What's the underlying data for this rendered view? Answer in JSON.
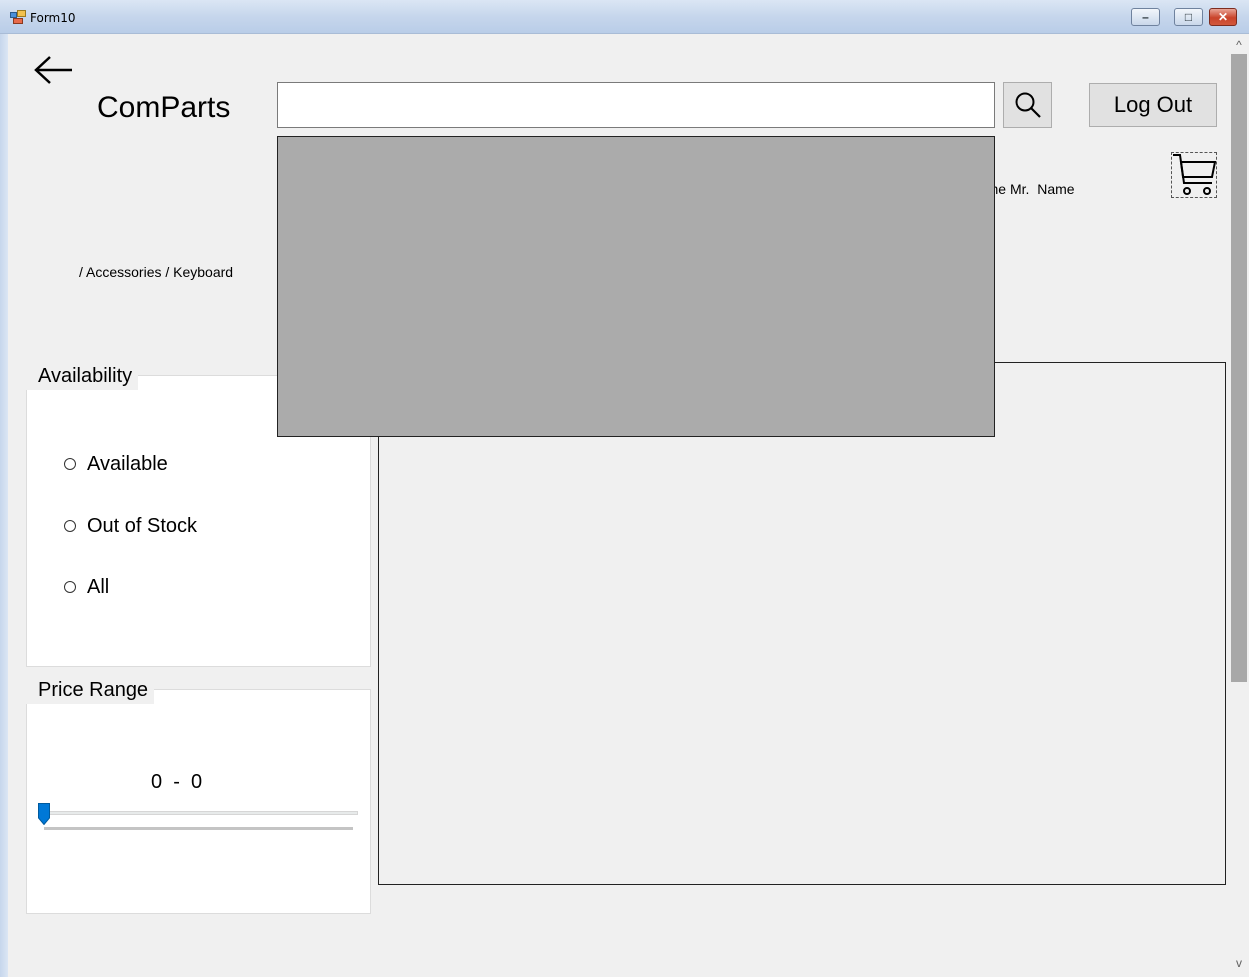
{
  "window": {
    "title": "Form10",
    "controls": {
      "minimize": "–",
      "maximize": "□",
      "close": "✕"
    }
  },
  "header": {
    "brand": "ComParts",
    "search": {
      "value": "",
      "placeholder": ""
    },
    "logout_label": "Log Out",
    "welcome_text": "Welcome Mr.  Name"
  },
  "breadcrumb": "/ Accessories / Keyboard",
  "filters": {
    "availability": {
      "title": "Availability",
      "options": [
        {
          "label": "Available"
        },
        {
          "label": "Out of Stock"
        },
        {
          "label": "All"
        }
      ]
    },
    "price_range": {
      "title": "Price Range",
      "display": "0  -  0",
      "slider_value": 0
    }
  },
  "icons": {
    "back": "back-arrow-icon",
    "search": "search-icon",
    "cart": "cart-icon",
    "app": "form-icon"
  },
  "scrollbar": {
    "up": "^",
    "down": "v"
  },
  "colors": {
    "window_bg": "#f0f0f0",
    "suggestion_panel": "#ababab",
    "slider_thumb": "#0078d7"
  }
}
